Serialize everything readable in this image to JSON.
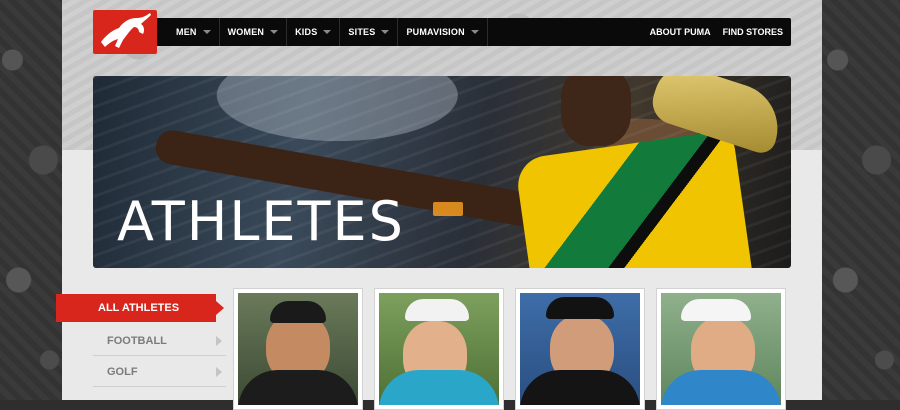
{
  "nav": {
    "items": [
      {
        "label": "MEN"
      },
      {
        "label": "WOMEN"
      },
      {
        "label": "KIDS"
      },
      {
        "label": "SITES"
      },
      {
        "label": "PUMAVISION"
      }
    ],
    "right_links": [
      {
        "label": "ABOUT PUMA"
      },
      {
        "label": "FIND STORES"
      }
    ]
  },
  "hero": {
    "title": "ATHLETES"
  },
  "sidebar": {
    "active": "ALL ATHLETES",
    "items": [
      {
        "label": "FOOTBALL"
      },
      {
        "label": "GOLF"
      }
    ]
  },
  "colors": {
    "brand_red": "#d9261c",
    "nav_bg": "#0a0a0a",
    "page_bg": "#e9e9e9"
  },
  "icons": {
    "logo": "puma-logo-icon",
    "nav_caret": "chevron-down-icon",
    "sidebar_chevron": "chevron-right-icon"
  }
}
